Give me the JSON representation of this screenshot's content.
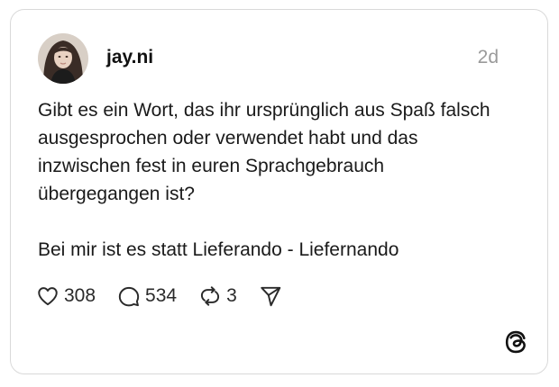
{
  "post": {
    "username": "jay.ni",
    "timestamp": "2d",
    "text_paragraph_1": "Gibt es ein Wort, das ihr ursprünglich aus Spaß falsch ausgesprochen oder verwendet habt und das inzwischen fest in euren Sprachgebrauch übergegangen ist?",
    "text_paragraph_2": "Bei mir ist es statt Lieferando - Liefernando"
  },
  "actions": {
    "likes": "308",
    "replies": "534",
    "reposts": "3"
  },
  "icons": {
    "like": "heart-icon",
    "reply": "comment-bubble-icon",
    "repost": "repost-icon",
    "share": "send-icon",
    "brand": "threads-logo-icon"
  },
  "colors": {
    "text": "#1a1a1a",
    "muted": "#9a9a9a",
    "border": "#d9d9d9"
  }
}
